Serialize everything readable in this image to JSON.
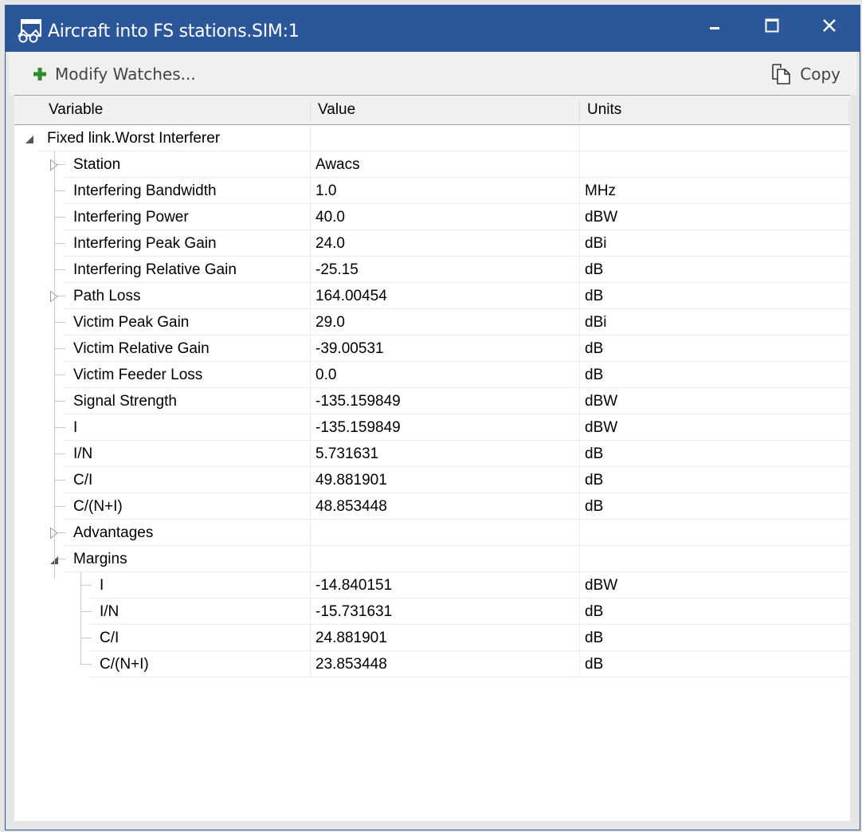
{
  "window": {
    "title": "Aircraft into FS stations.SIM:1",
    "icon": "watch-glasses-icon",
    "controls": {
      "minimize": "minimize-icon",
      "maximize": "maximize-icon",
      "close": "close-icon"
    },
    "colors": {
      "titlebar": "#2b579a",
      "accent_plus": "#2e8b2e"
    }
  },
  "toolbar": {
    "modify_label": "Modify Watches...",
    "copy_label": "Copy"
  },
  "table": {
    "columns": [
      "Variable",
      "Value",
      "Units"
    ],
    "rows": [
      {
        "variable": "Fixed link.Worst Interferer",
        "value": "",
        "units": "",
        "level": 0,
        "expander": "expanded"
      },
      {
        "variable": "Station",
        "value": "Awacs",
        "units": "",
        "level": 1,
        "expander": "collapsed"
      },
      {
        "variable": "Interfering Bandwidth",
        "value": "1.0",
        "units": "MHz",
        "level": 1,
        "expander": "none"
      },
      {
        "variable": "Interfering Power",
        "value": "40.0",
        "units": "dBW",
        "level": 1,
        "expander": "none"
      },
      {
        "variable": "Interfering Peak Gain",
        "value": "24.0",
        "units": "dBi",
        "level": 1,
        "expander": "none"
      },
      {
        "variable": "Interfering Relative Gain",
        "value": "-25.15",
        "units": "dB",
        "level": 1,
        "expander": "none"
      },
      {
        "variable": "Path Loss",
        "value": "164.00454",
        "units": "dB",
        "level": 1,
        "expander": "collapsed"
      },
      {
        "variable": "Victim Peak Gain",
        "value": "29.0",
        "units": "dBi",
        "level": 1,
        "expander": "none"
      },
      {
        "variable": "Victim Relative Gain",
        "value": "-39.00531",
        "units": "dB",
        "level": 1,
        "expander": "none"
      },
      {
        "variable": "Victim Feeder Loss",
        "value": "0.0",
        "units": "dB",
        "level": 1,
        "expander": "none"
      },
      {
        "variable": "Signal Strength",
        "value": "-135.159849",
        "units": "dBW",
        "level": 1,
        "expander": "none"
      },
      {
        "variable": "I",
        "value": "-135.159849",
        "units": "dBW",
        "level": 1,
        "expander": "none"
      },
      {
        "variable": "I/N",
        "value": "5.731631",
        "units": "dB",
        "level": 1,
        "expander": "none"
      },
      {
        "variable": "C/I",
        "value": "49.881901",
        "units": "dB",
        "level": 1,
        "expander": "none"
      },
      {
        "variable": "C/(N+I)",
        "value": "48.853448",
        "units": "dB",
        "level": 1,
        "expander": "none"
      },
      {
        "variable": "Advantages",
        "value": "",
        "units": "",
        "level": 1,
        "expander": "collapsed"
      },
      {
        "variable": "Margins",
        "value": "",
        "units": "",
        "level": 1,
        "expander": "expanded"
      },
      {
        "variable": "I",
        "value": "-14.840151",
        "units": "dBW",
        "level": 2,
        "expander": "none"
      },
      {
        "variable": "I/N",
        "value": "-15.731631",
        "units": "dB",
        "level": 2,
        "expander": "none"
      },
      {
        "variable": "C/I",
        "value": "24.881901",
        "units": "dB",
        "level": 2,
        "expander": "none"
      },
      {
        "variable": "C/(N+I)",
        "value": "23.853448",
        "units": "dB",
        "level": 2,
        "expander": "none"
      }
    ]
  }
}
